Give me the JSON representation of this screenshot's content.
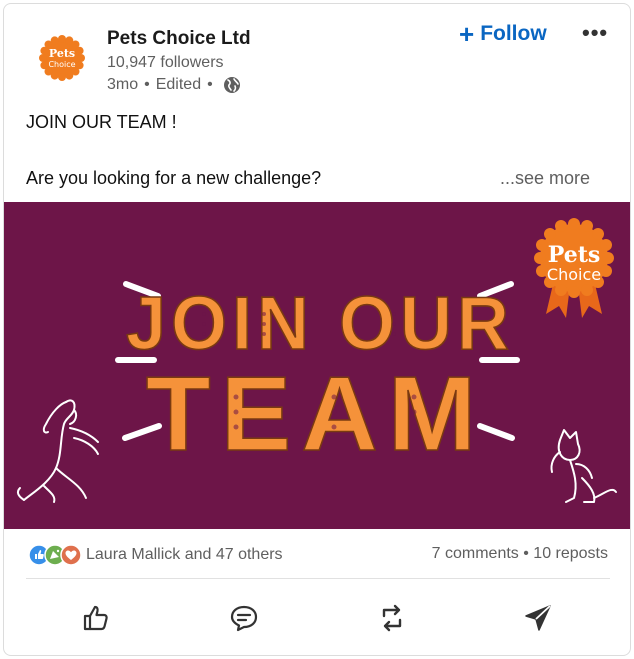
{
  "post": {
    "company_name": "Pets Choice Ltd",
    "followers": "10,947 followers",
    "time": "3mo",
    "sep1": "•",
    "edited": "Edited",
    "sep2": "•",
    "follow_plus": "+",
    "follow_label": "Follow",
    "more_label": "•••",
    "text_line1": "JOIN OUR TEAM !",
    "text_line2": "Are you looking for a new challenge?",
    "see_more": "...see more"
  },
  "logo": {
    "line1": "Pets",
    "line2": "Choice"
  },
  "banner": {
    "line1": "JOIN OUR",
    "line2": "TEAM",
    "logo_line1": "Pets",
    "logo_line2": "Choice"
  },
  "social": {
    "reacted_by": "Laura Mallick and 47 others",
    "stats": "7 comments • 10 reposts"
  },
  "actions": [
    "like-icon",
    "comment-icon",
    "repost-icon",
    "send-icon"
  ],
  "colors": {
    "brand_orange": "#f07c1f",
    "banner_purple": "#6d1548",
    "follow_blue": "#0a66c2",
    "banner_text": "#f5923a"
  }
}
